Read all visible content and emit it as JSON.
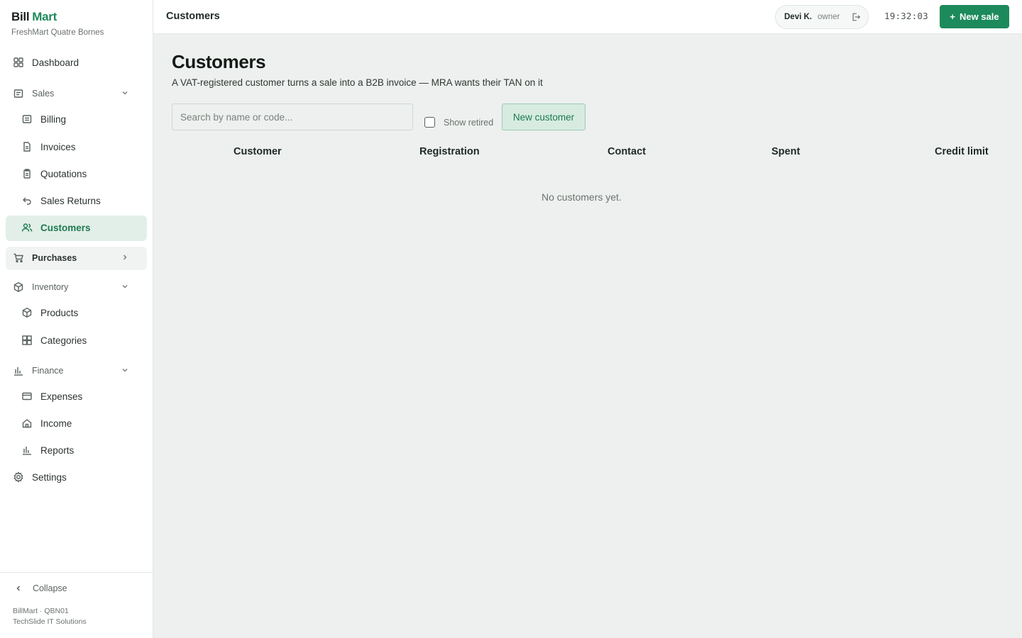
{
  "brand": {
    "part1": "Bill",
    "part2": "Mart",
    "store": "FreshMart Quatre Bornes"
  },
  "sidebar": {
    "dashboard": "Dashboard",
    "sales_group": "Sales",
    "billing": "Billing",
    "invoices": "Invoices",
    "quotations": "Quotations",
    "sales_returns": "Sales Returns",
    "customers": "Customers",
    "purchases": "Purchases",
    "inventory_group": "Inventory",
    "products": "Products",
    "categories": "Categories",
    "finance_group": "Finance",
    "expenses": "Expenses",
    "income": "Income",
    "reports": "Reports",
    "settings": "Settings",
    "collapse": "Collapse",
    "meta_line1": "BillMart · QBN01",
    "meta_line2": "TechSlide IT Solutions"
  },
  "topbar": {
    "title": "Customers",
    "user_name": "Devi K.",
    "user_role": "owner",
    "clock": "19:32:03",
    "new_sale": "New sale",
    "new_sale_icon": "+"
  },
  "main": {
    "title": "Customers",
    "subtitle": "A VAT-registered customer turns a sale into a B2B invoice — MRA wants their TAN on it",
    "search_placeholder": "Search by name or code...",
    "show_retired": "Show retired",
    "new_customer": "New customer",
    "columns": [
      "Customer",
      "Registration",
      "Contact",
      "Spent",
      "Credit limit"
    ],
    "empty_text": "No customers yet."
  },
  "colors": {
    "accent": "#1d8a5b",
    "active_bg": "#e2efe8",
    "page_bg": "#edf0ee"
  }
}
